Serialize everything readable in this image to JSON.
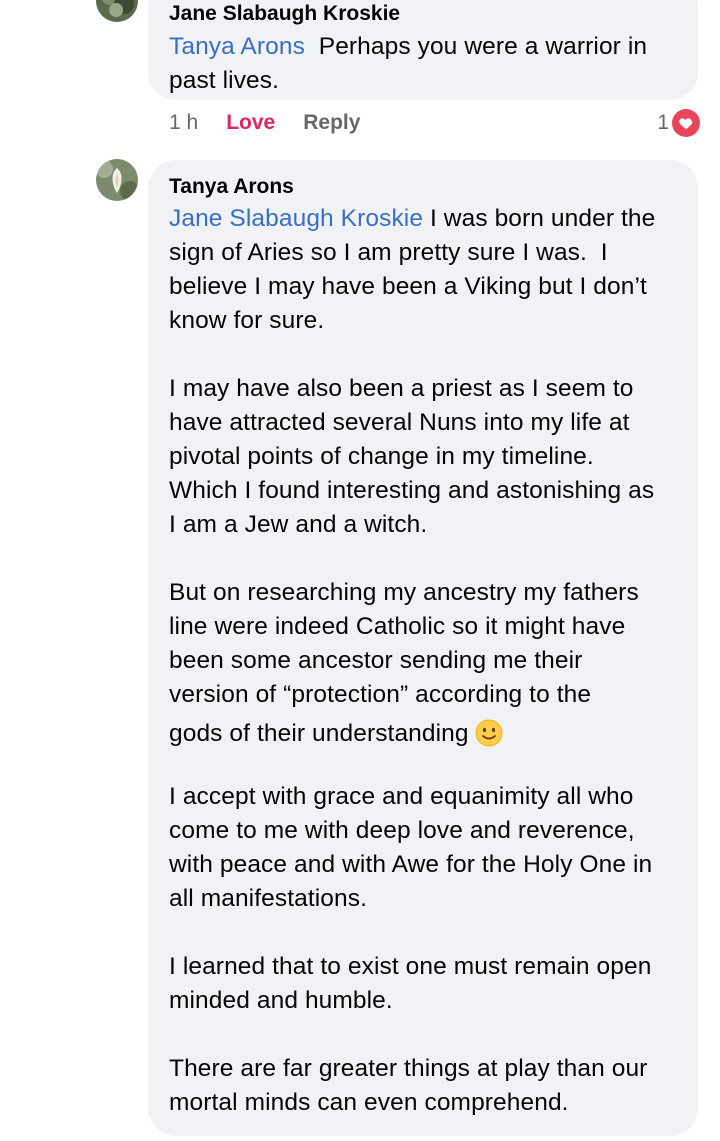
{
  "comment1": {
    "author": "Jane Slabaugh Kroskie",
    "mention": "Tanya Arons",
    "text_line1": "  Perhaps you were a warrior in",
    "text_line2": "past lives.",
    "time": "1 h",
    "love_label": "Love",
    "reply_label": "Reply",
    "reaction_count": "1",
    "reaction_icon": "heart-icon",
    "reaction_color": "#e8445a"
  },
  "comment2": {
    "author": "Tanya Arons",
    "mention": "Jane Slabaugh Kroskie",
    "p1_line1": " I was born under the",
    "p1_line2": "sign of Aries so I am pretty sure I was.  I",
    "p1_line3": "believe I may have been a Viking but I don’t",
    "p1_line4": "know for sure.",
    "p2_line1": "I may have also been a priest as I seem to",
    "p2_line2": "have attracted several Nuns into my life at",
    "p2_line3": "pivotal points of change in my timeline.",
    "p2_line4": "Which I found interesting and astonishing as",
    "p2_line5": "I am a Jew and a witch.",
    "p3_line1": "But on researching my ancestry my fathers",
    "p3_line2": "line were indeed Catholic so it might have",
    "p3_line3": "been some ancestor sending me their",
    "p3_line4": "version of “protection” according to the",
    "p3_line5": "gods of their understanding",
    "p3_emoji": "slightly-smiling-face-emoji",
    "p4_line1": "I accept with grace and equanimity all who",
    "p4_line2": "come to me with deep love and reverence,",
    "p4_line3": "with peace and with Awe for the Holy One in",
    "p4_line4": "all manifestations.",
    "p5_line1": "I learned that to exist one must remain open",
    "p5_line2": "minded and humble.",
    "p6_line1": "There are far greater things at play than our",
    "p6_line2": "mortal minds can even comprehend."
  },
  "colors": {
    "bubble_bg": "#f0f2f5",
    "mention": "#3a6ec2",
    "love": "#e0245e",
    "meta": "#65676b"
  }
}
